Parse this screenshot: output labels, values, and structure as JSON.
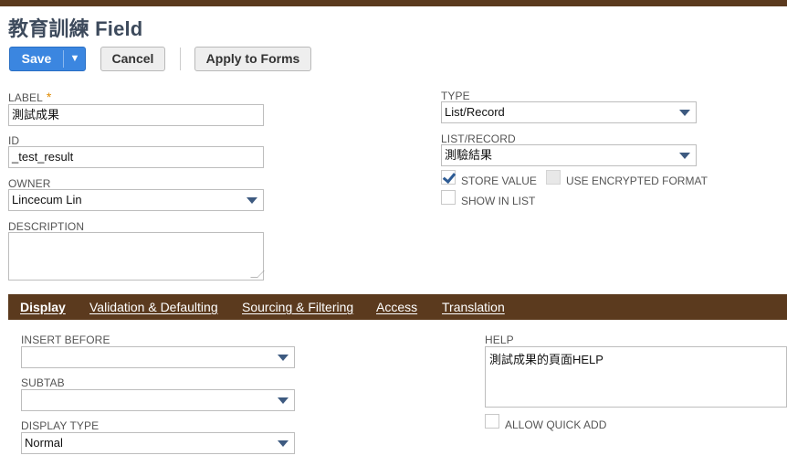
{
  "page": {
    "title": "教育訓練 Field"
  },
  "toolbar": {
    "save_label": "Save",
    "save_menu_glyph": "▼",
    "cancel_label": "Cancel",
    "apply_label": "Apply to Forms"
  },
  "fields": {
    "label": {
      "label": "LABEL",
      "required_mark": "*",
      "value": "測試成果"
    },
    "id": {
      "label": "ID",
      "value": "_test_result"
    },
    "owner": {
      "label": "OWNER",
      "value": "Lincecum Lin"
    },
    "description": {
      "label": "DESCRIPTION",
      "value": ""
    },
    "type": {
      "label": "TYPE",
      "value": "List/Record"
    },
    "list_record": {
      "label": "LIST/RECORD",
      "value": "測驗結果"
    },
    "store_value": {
      "label": "STORE VALUE",
      "checked": true
    },
    "use_encrypted": {
      "label": "USE ENCRYPTED FORMAT",
      "checked": false,
      "disabled": true
    },
    "show_in_list": {
      "label": "SHOW IN LIST",
      "checked": false
    }
  },
  "tabs": [
    {
      "label": "Display",
      "active": true
    },
    {
      "label": "Validation & Defaulting"
    },
    {
      "label": "Sourcing & Filtering"
    },
    {
      "label": "Access"
    },
    {
      "label": "Translation"
    }
  ],
  "display": {
    "insert_before": {
      "label": "INSERT BEFORE",
      "value": ""
    },
    "subtab": {
      "label": "SUBTAB",
      "value": ""
    },
    "display_type": {
      "label": "DISPLAY TYPE",
      "value": "Normal"
    },
    "help": {
      "label": "HELP",
      "value": "測試成果的頁面HELP"
    },
    "allow_quick_add": {
      "label": "ALLOW QUICK ADD",
      "checked": false
    }
  },
  "colors": {
    "header_brown": "#5b3a1e",
    "save_blue": "#3b86e0",
    "title": "#3d4a5c"
  },
  "icons": {
    "dropdown": "chevron-down-icon",
    "check": "checkmark-icon"
  }
}
